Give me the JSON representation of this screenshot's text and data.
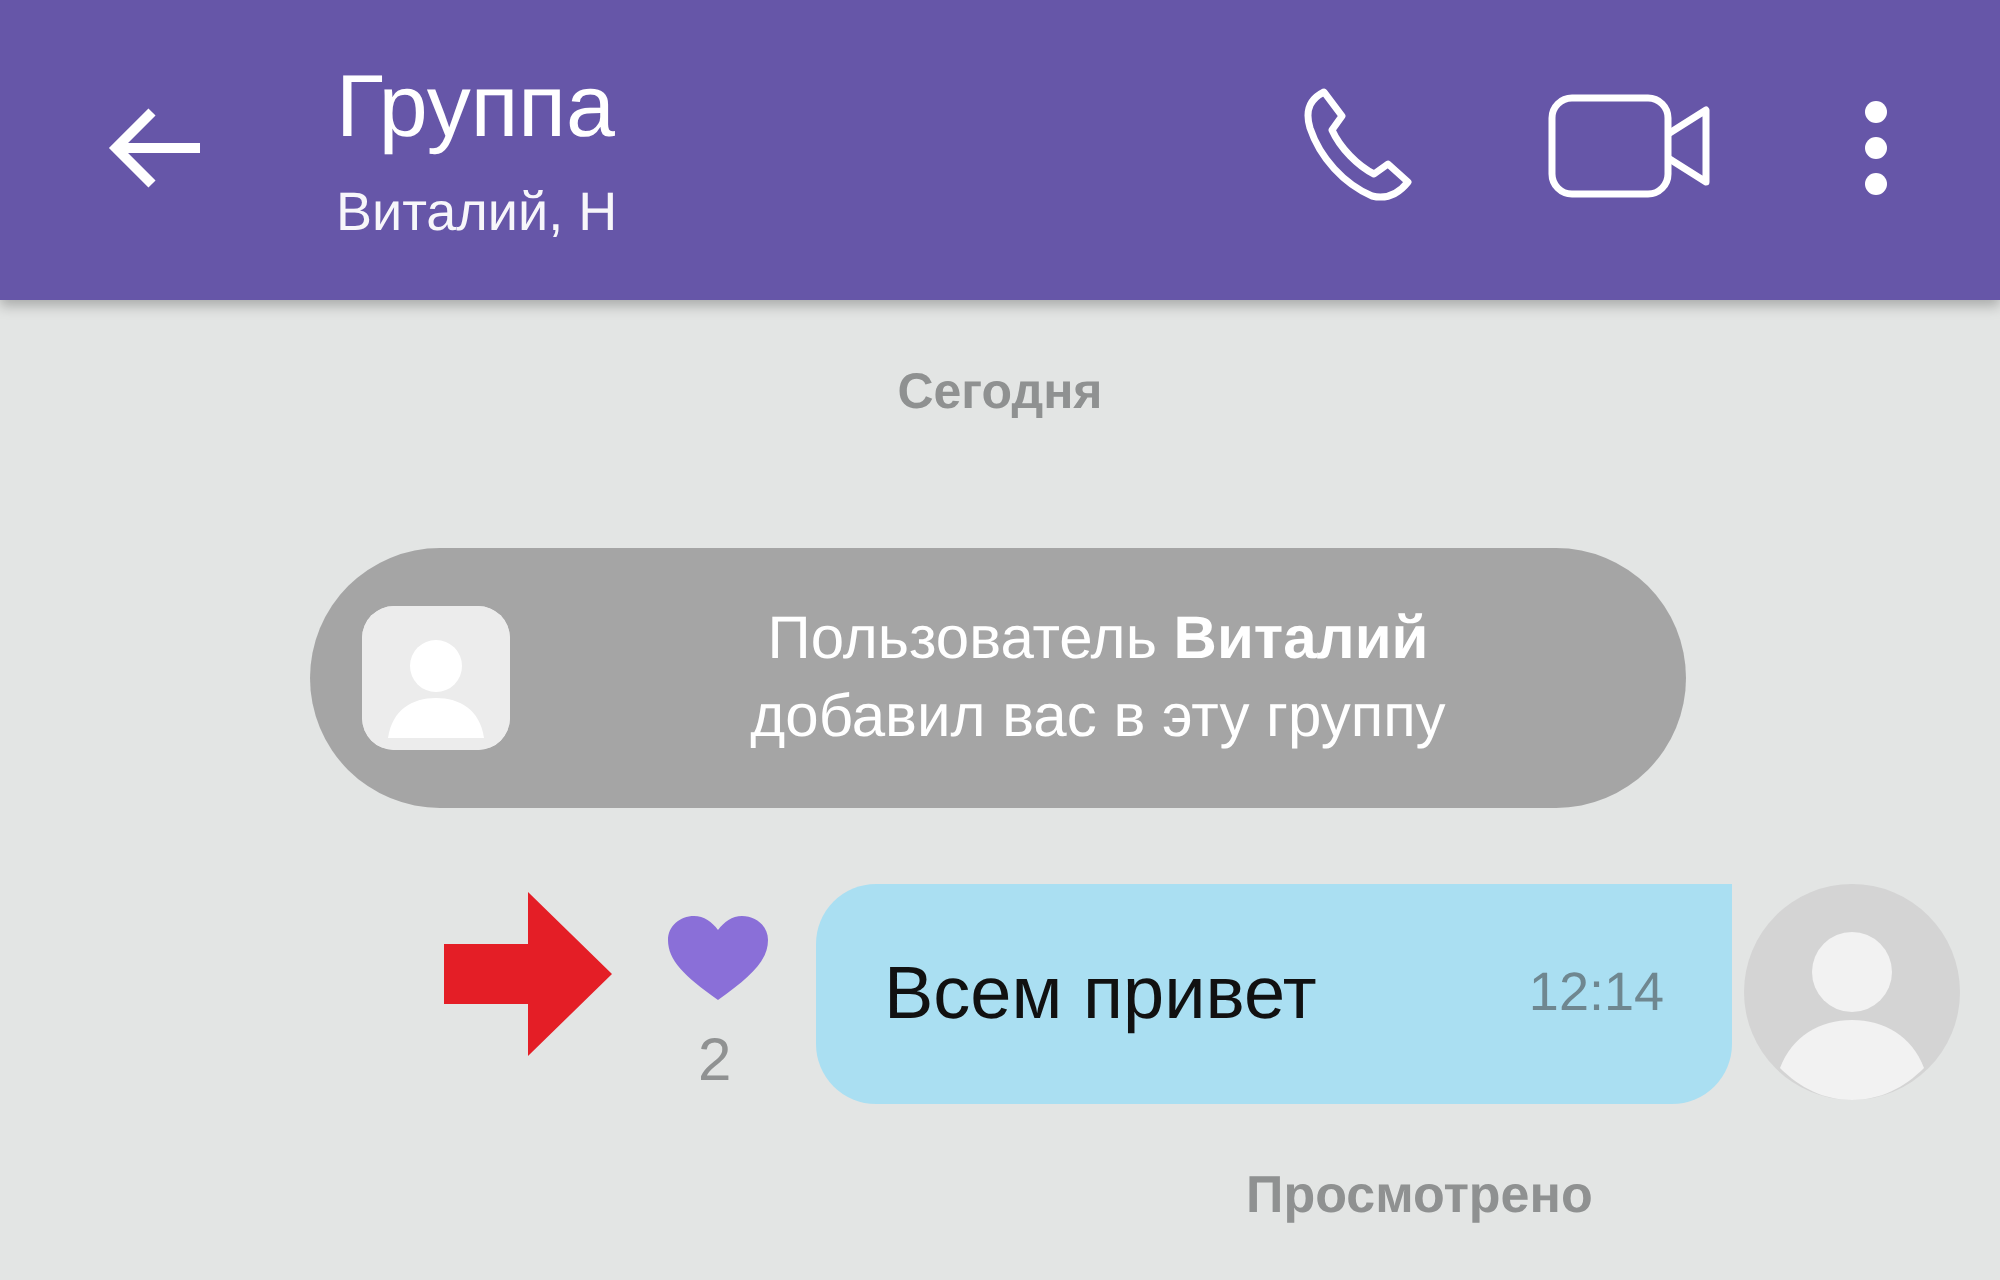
{
  "header": {
    "title": "Группа",
    "subtitle": "Виталий, Н"
  },
  "date_label": "Сегодня",
  "system_message": {
    "text": "Пользователь **Виталий**\nдобавил вас в эту группу"
  },
  "message": {
    "text": "Всем привет",
    "time": "12:14",
    "likes": "2",
    "liked": true,
    "status": "Просмотрено"
  }
}
